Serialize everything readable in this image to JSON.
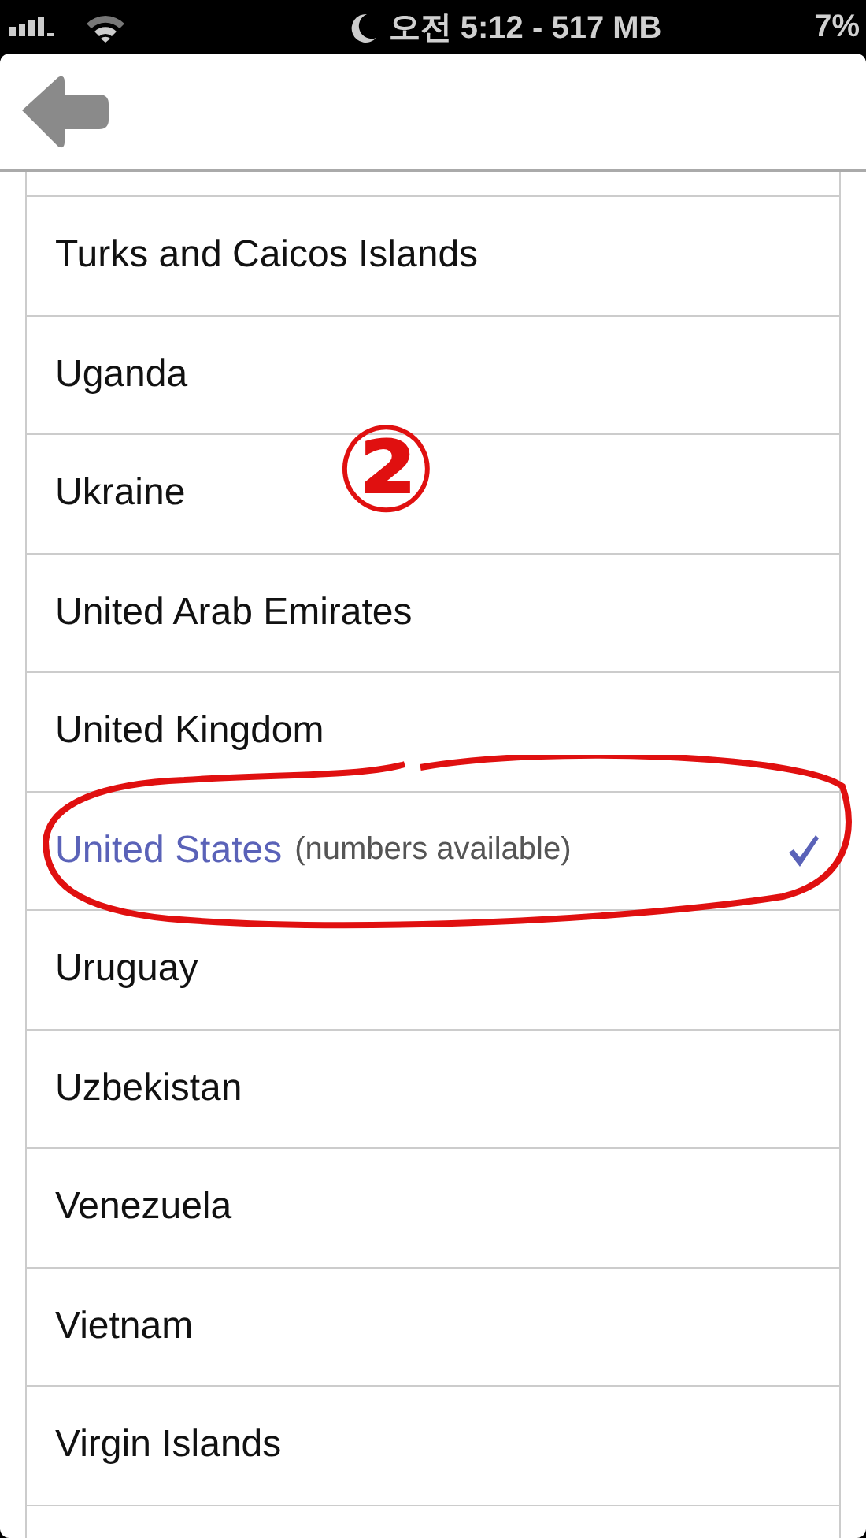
{
  "status_bar": {
    "time": "오전 5:12 - 517 MB",
    "battery": "7%"
  },
  "countries": [
    {
      "name": "Turks and Caicos Islands",
      "selected": false
    },
    {
      "name": "Uganda",
      "selected": false
    },
    {
      "name": "Ukraine",
      "selected": false
    },
    {
      "name": "United Arab Emirates",
      "selected": false
    },
    {
      "name": "United Kingdom",
      "selected": false
    },
    {
      "name": "United States",
      "note": "(numbers available)",
      "selected": true
    },
    {
      "name": "Uruguay",
      "selected": false
    },
    {
      "name": "Uzbekistan",
      "selected": false
    },
    {
      "name": "Venezuela",
      "selected": false
    },
    {
      "name": "Vietnam",
      "selected": false
    },
    {
      "name": "Virgin Islands",
      "selected": false
    }
  ],
  "annotation": {
    "marker": "②"
  }
}
